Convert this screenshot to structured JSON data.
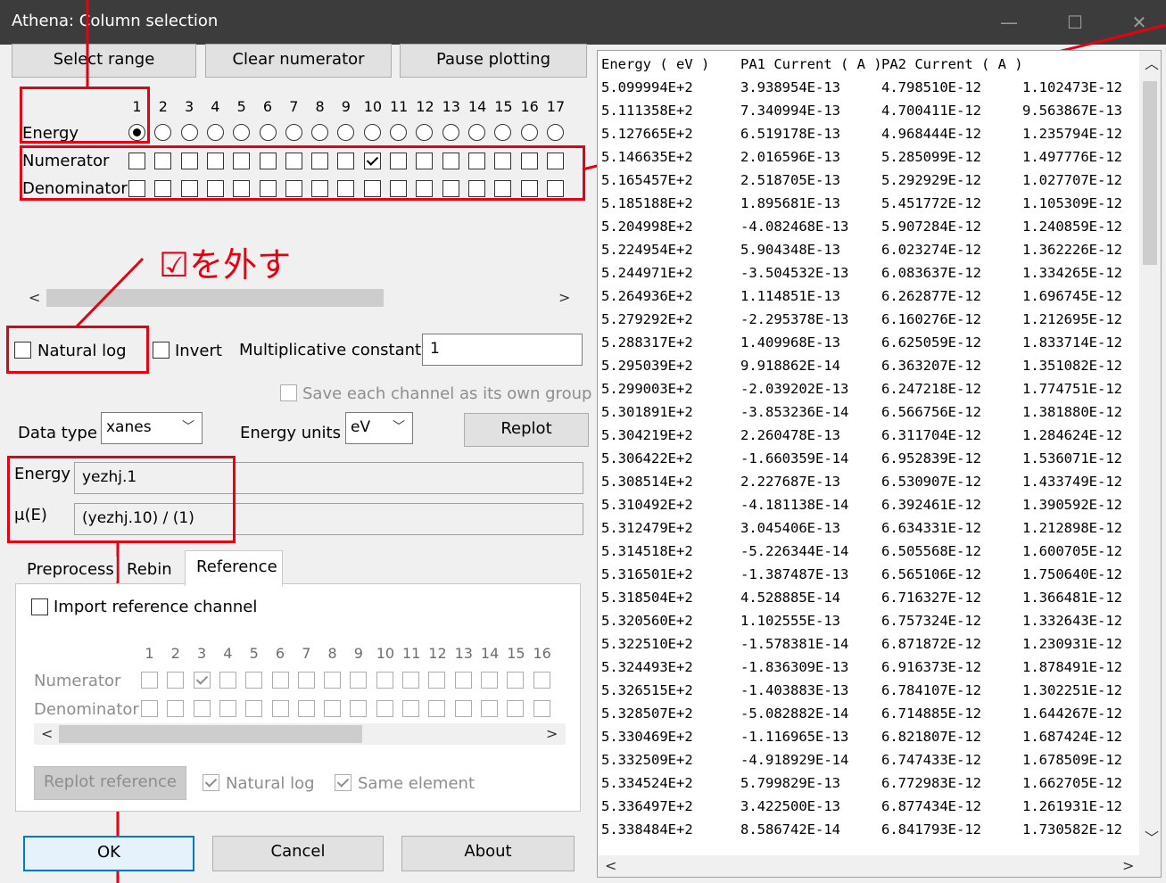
{
  "window": {
    "title": "Athena: Column selection",
    "controls": {
      "minimize": "—",
      "maximize": "☐",
      "close": "✕"
    }
  },
  "buttons": {
    "select_range": "Select range",
    "clear_numerator": "Clear numerator",
    "pause_plotting": "Pause plotting",
    "replot": "Replot",
    "replot_reference": "Replot reference",
    "ok": "OK",
    "cancel": "Cancel",
    "about": "About"
  },
  "columns": {
    "numbers": [
      "1",
      "2",
      "3",
      "4",
      "5",
      "6",
      "7",
      "8",
      "9",
      "10",
      "11",
      "12",
      "13",
      "14",
      "15",
      "16",
      "17"
    ],
    "energy_label": "Energy",
    "numerator_label": "Numerator",
    "denominator_label": "Denominator",
    "energy_selected": 1,
    "numerator_checked": [
      10
    ],
    "denominator_checked": []
  },
  "options": {
    "natural_log": {
      "label": "Natural log",
      "checked": false
    },
    "invert": {
      "label": "Invert",
      "checked": false
    },
    "mult_const_label": "Multiplicative constant",
    "mult_const_value": "1",
    "save_each_channel": {
      "label": "Save each channel as its own group",
      "checked": false
    }
  },
  "data_type": {
    "label": "Data type",
    "value": "xanes"
  },
  "energy_units": {
    "label": "Energy units",
    "value": "eV"
  },
  "expressions": {
    "energy_label": "Energy",
    "energy_value": "yezhj.1",
    "mu_label": "μ(E)",
    "mu_value": "(yezhj.10) / (1)"
  },
  "tabs": {
    "preprocess": "Preprocess",
    "rebin": "Rebin",
    "reference": "Reference",
    "active": "Reference"
  },
  "reference": {
    "import_label": "Import reference channel",
    "numbers": [
      "1",
      "2",
      "3",
      "4",
      "5",
      "6",
      "7",
      "8",
      "9",
      "10",
      "11",
      "12",
      "13",
      "14",
      "15",
      "16"
    ],
    "numerator_label": "Numerator",
    "denominator_label": "Denominator",
    "numerator_checked": [
      3
    ],
    "natural_log": {
      "label": "Natural log",
      "checked": true
    },
    "same_element": {
      "label": "Same element",
      "checked": true
    }
  },
  "annotation": {
    "text": "☑を外す",
    "color": "#e60012"
  },
  "table": {
    "headers": [
      "Energy ( eV )",
      "PA1 Current ( A )",
      "PA2 Current ( A )",
      ""
    ],
    "rows": [
      [
        "5.099994E+2",
        "3.938954E-13",
        "4.798510E-12",
        "1.102473E-12"
      ],
      [
        "5.111358E+2",
        "7.340994E-13",
        "4.700411E-12",
        "9.563867E-13"
      ],
      [
        "5.127665E+2",
        "6.519178E-13",
        "4.968444E-12",
        "1.235794E-12"
      ],
      [
        "5.146635E+2",
        "2.016596E-13",
        "5.285099E-12",
        "1.497776E-12"
      ],
      [
        "5.165457E+2",
        "2.518705E-13",
        "5.292929E-12",
        "1.027707E-12"
      ],
      [
        "5.185188E+2",
        "1.895681E-13",
        "5.451772E-12",
        "1.105309E-12"
      ],
      [
        "5.204998E+2",
        "-4.082468E-13",
        "5.907284E-12",
        "1.240859E-12"
      ],
      [
        "5.224954E+2",
        "5.904348E-13",
        "6.023274E-12",
        "1.362226E-12"
      ],
      [
        "5.244971E+2",
        "-3.504532E-13",
        "6.083637E-12",
        "1.334265E-12"
      ],
      [
        "5.264936E+2",
        "1.114851E-13",
        "6.262877E-12",
        "1.696745E-12"
      ],
      [
        "5.279292E+2",
        "-2.295378E-13",
        "6.160276E-12",
        "1.212695E-12"
      ],
      [
        "5.288317E+2",
        "1.409968E-13",
        "6.625059E-12",
        "1.833714E-12"
      ],
      [
        "5.295039E+2",
        "9.918862E-14",
        "6.363207E-12",
        "1.351082E-12"
      ],
      [
        "5.299003E+2",
        "-2.039202E-13",
        "6.247218E-12",
        "1.774751E-12"
      ],
      [
        "5.301891E+2",
        "-3.853236E-14",
        "6.566756E-12",
        "1.381880E-12"
      ],
      [
        "5.304219E+2",
        "2.260478E-13",
        "6.311704E-12",
        "1.284624E-12"
      ],
      [
        "5.306422E+2",
        "-1.660359E-14",
        "6.952839E-12",
        "1.536071E-12"
      ],
      [
        "5.308514E+2",
        "2.227687E-13",
        "6.530907E-12",
        "1.433749E-12"
      ],
      [
        "5.310492E+2",
        "-4.181138E-14",
        "6.392461E-12",
        "1.390592E-12"
      ],
      [
        "5.312479E+2",
        "3.045406E-13",
        "6.634331E-12",
        "1.212898E-12"
      ],
      [
        "5.314518E+2",
        "-5.226344E-14",
        "6.505568E-12",
        "1.600705E-12"
      ],
      [
        "5.316501E+2",
        "-1.387487E-13",
        "6.565106E-12",
        "1.750640E-12"
      ],
      [
        "5.318504E+2",
        "4.528885E-14",
        "6.716327E-12",
        "1.366481E-12"
      ],
      [
        "5.320560E+2",
        "1.102555E-13",
        "6.757324E-12",
        "1.332643E-12"
      ],
      [
        "5.322510E+2",
        "-1.578381E-14",
        "6.871872E-12",
        "1.230931E-12"
      ],
      [
        "5.324493E+2",
        "-1.836309E-13",
        "6.916373E-12",
        "1.878491E-12"
      ],
      [
        "5.326515E+2",
        "-1.403883E-13",
        "6.784107E-12",
        "1.302251E-12"
      ],
      [
        "5.328507E+2",
        "-5.082882E-14",
        "6.714885E-12",
        "1.644267E-12"
      ],
      [
        "5.330469E+2",
        "-1.116965E-13",
        "6.821807E-12",
        "1.687424E-12"
      ],
      [
        "5.332509E+2",
        "-4.918929E-14",
        "6.747433E-12",
        "1.678509E-12"
      ],
      [
        "5.334524E+2",
        "5.799829E-13",
        "6.772983E-12",
        "1.662705E-12"
      ],
      [
        "5.336497E+2",
        "3.422500E-13",
        "6.877434E-12",
        "1.261931E-12"
      ],
      [
        "5.338484E+2",
        "8.586742E-14",
        "6.841793E-12",
        "1.730582E-12"
      ]
    ]
  }
}
